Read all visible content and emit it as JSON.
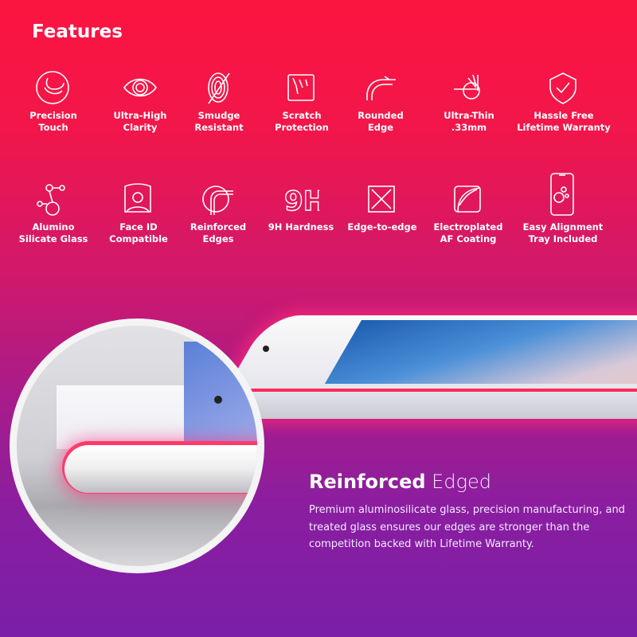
{
  "title": "Features",
  "features_row1": [
    {
      "icon": "precision-touch-icon",
      "label1": "Precision",
      "label2": "Touch"
    },
    {
      "icon": "eye-icon",
      "label1": "Ultra-High",
      "label2": "Clarity"
    },
    {
      "icon": "fingerprint-icon",
      "label1": "Smudge",
      "label2": "Resistant"
    },
    {
      "icon": "scratch-icon",
      "label1": "Scratch",
      "label2": "Protection"
    },
    {
      "icon": "rounded-edge-icon",
      "label1": "Rounded",
      "label2": "Edge"
    },
    {
      "icon": "ultra-thin-icon",
      "label1": "Ultra-Thin",
      "label2": ".33mm"
    },
    {
      "icon": "shield-check-icon",
      "label1": "Hassle Free",
      "label2": "Lifetime Warranty"
    }
  ],
  "features_row2": [
    {
      "icon": "molecule-icon",
      "label1": "Alumino",
      "label2": "Silicate Glass"
    },
    {
      "icon": "face-id-icon",
      "label1": "Face ID",
      "label2": "Compatible"
    },
    {
      "icon": "reinforced-edge-icon",
      "label1": "Reinforced",
      "label2": "Edges"
    },
    {
      "icon": "9h-icon",
      "label1": "9H Hardness",
      "label2": ""
    },
    {
      "icon": "edge-to-edge-icon",
      "label1": "Edge-to-edge",
      "label2": ""
    },
    {
      "icon": "af-coating-icon",
      "label1": "Electroplated",
      "label2": "AF Coating"
    },
    {
      "icon": "phone-tray-icon",
      "label1": "Easy Alignment",
      "label2": "Tray Included"
    }
  ],
  "heading_bold": "Reinforced",
  "heading_light": "Edged",
  "description": "Premium aluminosilicate glass, precision manufacturing, and treated glass ensures our edges are stronger than the competition backed with Lifetime Warranty.",
  "colors": {
    "top": "#fb1440",
    "bottom": "#7a1fa8",
    "glow": "#ff2a5a"
  }
}
